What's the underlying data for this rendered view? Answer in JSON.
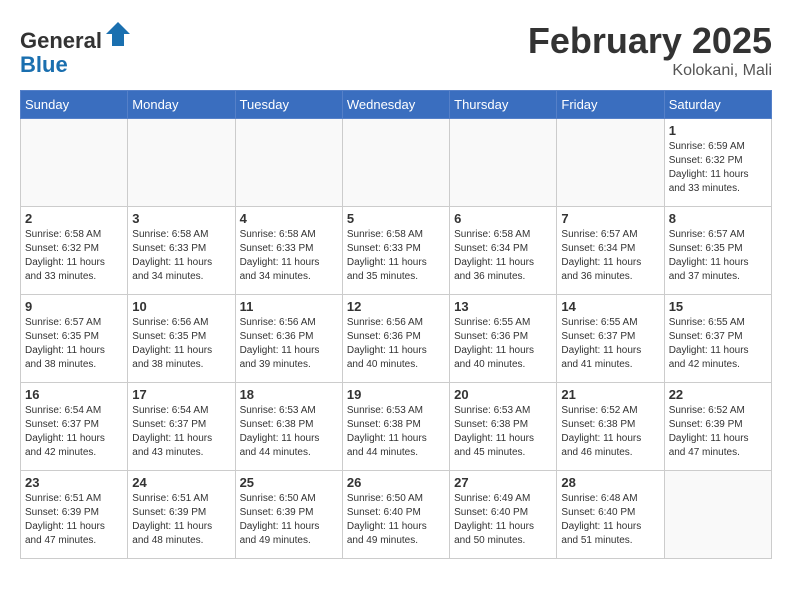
{
  "header": {
    "logo_line1": "General",
    "logo_line2": "Blue",
    "month_title": "February 2025",
    "location": "Kolokani, Mali"
  },
  "weekdays": [
    "Sunday",
    "Monday",
    "Tuesday",
    "Wednesday",
    "Thursday",
    "Friday",
    "Saturday"
  ],
  "weeks": [
    [
      {
        "day": "",
        "info": ""
      },
      {
        "day": "",
        "info": ""
      },
      {
        "day": "",
        "info": ""
      },
      {
        "day": "",
        "info": ""
      },
      {
        "day": "",
        "info": ""
      },
      {
        "day": "",
        "info": ""
      },
      {
        "day": "1",
        "info": "Sunrise: 6:59 AM\nSunset: 6:32 PM\nDaylight: 11 hours\nand 33 minutes."
      }
    ],
    [
      {
        "day": "2",
        "info": "Sunrise: 6:58 AM\nSunset: 6:32 PM\nDaylight: 11 hours\nand 33 minutes."
      },
      {
        "day": "3",
        "info": "Sunrise: 6:58 AM\nSunset: 6:33 PM\nDaylight: 11 hours\nand 34 minutes."
      },
      {
        "day": "4",
        "info": "Sunrise: 6:58 AM\nSunset: 6:33 PM\nDaylight: 11 hours\nand 34 minutes."
      },
      {
        "day": "5",
        "info": "Sunrise: 6:58 AM\nSunset: 6:33 PM\nDaylight: 11 hours\nand 35 minutes."
      },
      {
        "day": "6",
        "info": "Sunrise: 6:58 AM\nSunset: 6:34 PM\nDaylight: 11 hours\nand 36 minutes."
      },
      {
        "day": "7",
        "info": "Sunrise: 6:57 AM\nSunset: 6:34 PM\nDaylight: 11 hours\nand 36 minutes."
      },
      {
        "day": "8",
        "info": "Sunrise: 6:57 AM\nSunset: 6:35 PM\nDaylight: 11 hours\nand 37 minutes."
      }
    ],
    [
      {
        "day": "9",
        "info": "Sunrise: 6:57 AM\nSunset: 6:35 PM\nDaylight: 11 hours\nand 38 minutes."
      },
      {
        "day": "10",
        "info": "Sunrise: 6:56 AM\nSunset: 6:35 PM\nDaylight: 11 hours\nand 38 minutes."
      },
      {
        "day": "11",
        "info": "Sunrise: 6:56 AM\nSunset: 6:36 PM\nDaylight: 11 hours\nand 39 minutes."
      },
      {
        "day": "12",
        "info": "Sunrise: 6:56 AM\nSunset: 6:36 PM\nDaylight: 11 hours\nand 40 minutes."
      },
      {
        "day": "13",
        "info": "Sunrise: 6:55 AM\nSunset: 6:36 PM\nDaylight: 11 hours\nand 40 minutes."
      },
      {
        "day": "14",
        "info": "Sunrise: 6:55 AM\nSunset: 6:37 PM\nDaylight: 11 hours\nand 41 minutes."
      },
      {
        "day": "15",
        "info": "Sunrise: 6:55 AM\nSunset: 6:37 PM\nDaylight: 11 hours\nand 42 minutes."
      }
    ],
    [
      {
        "day": "16",
        "info": "Sunrise: 6:54 AM\nSunset: 6:37 PM\nDaylight: 11 hours\nand 42 minutes."
      },
      {
        "day": "17",
        "info": "Sunrise: 6:54 AM\nSunset: 6:37 PM\nDaylight: 11 hours\nand 43 minutes."
      },
      {
        "day": "18",
        "info": "Sunrise: 6:53 AM\nSunset: 6:38 PM\nDaylight: 11 hours\nand 44 minutes."
      },
      {
        "day": "19",
        "info": "Sunrise: 6:53 AM\nSunset: 6:38 PM\nDaylight: 11 hours\nand 44 minutes."
      },
      {
        "day": "20",
        "info": "Sunrise: 6:53 AM\nSunset: 6:38 PM\nDaylight: 11 hours\nand 45 minutes."
      },
      {
        "day": "21",
        "info": "Sunrise: 6:52 AM\nSunset: 6:38 PM\nDaylight: 11 hours\nand 46 minutes."
      },
      {
        "day": "22",
        "info": "Sunrise: 6:52 AM\nSunset: 6:39 PM\nDaylight: 11 hours\nand 47 minutes."
      }
    ],
    [
      {
        "day": "23",
        "info": "Sunrise: 6:51 AM\nSunset: 6:39 PM\nDaylight: 11 hours\nand 47 minutes."
      },
      {
        "day": "24",
        "info": "Sunrise: 6:51 AM\nSunset: 6:39 PM\nDaylight: 11 hours\nand 48 minutes."
      },
      {
        "day": "25",
        "info": "Sunrise: 6:50 AM\nSunset: 6:39 PM\nDaylight: 11 hours\nand 49 minutes."
      },
      {
        "day": "26",
        "info": "Sunrise: 6:50 AM\nSunset: 6:40 PM\nDaylight: 11 hours\nand 49 minutes."
      },
      {
        "day": "27",
        "info": "Sunrise: 6:49 AM\nSunset: 6:40 PM\nDaylight: 11 hours\nand 50 minutes."
      },
      {
        "day": "28",
        "info": "Sunrise: 6:48 AM\nSunset: 6:40 PM\nDaylight: 11 hours\nand 51 minutes."
      },
      {
        "day": "",
        "info": ""
      }
    ]
  ]
}
